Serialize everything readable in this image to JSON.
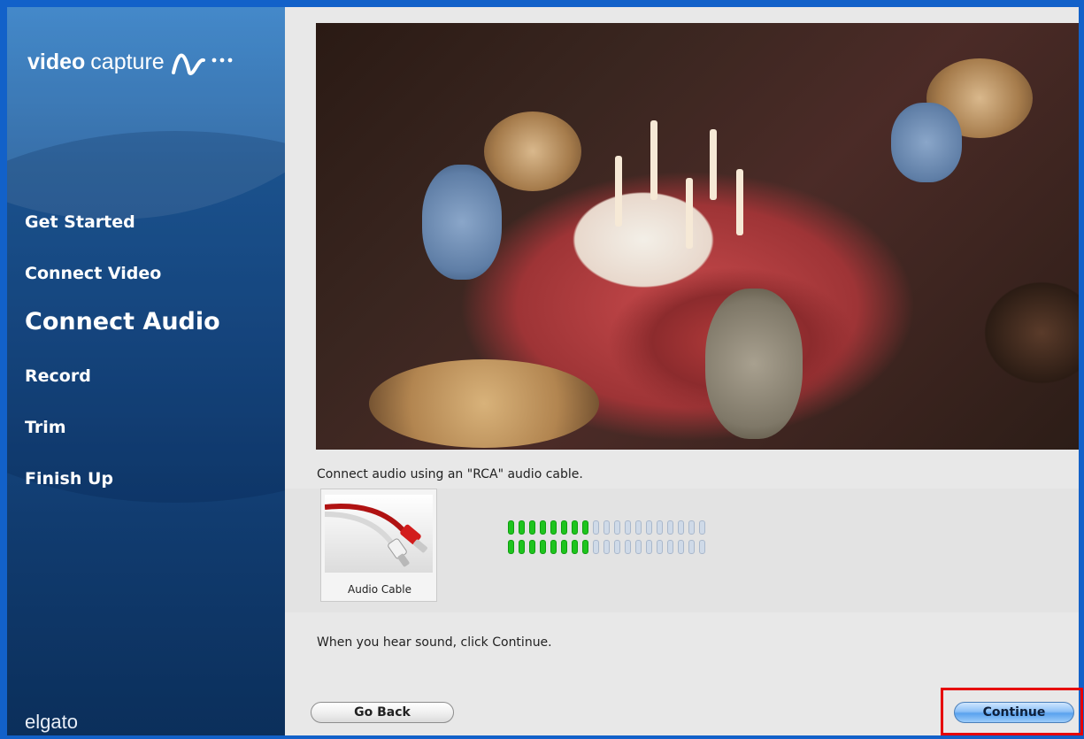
{
  "app": {
    "logo_bold": "video",
    "logo_light": "capture",
    "brand": "elgato"
  },
  "steps": [
    {
      "label": "Get Started",
      "active": false
    },
    {
      "label": "Connect Video",
      "active": false
    },
    {
      "label": "Connect Audio",
      "active": true
    },
    {
      "label": "Record",
      "active": false
    },
    {
      "label": "Trim",
      "active": false
    },
    {
      "label": "Finish Up",
      "active": false
    }
  ],
  "content": {
    "instruction_cable": "Connect audio using an \"RCA\" audio cable.",
    "cable_label": "Audio Cable",
    "instruction_continue": "When you hear sound, click Continue."
  },
  "meter": {
    "total_segments": 19,
    "left_level": 8,
    "right_level": 8
  },
  "buttons": {
    "back": "Go Back",
    "continue": "Continue"
  },
  "colors": {
    "accent_border": "#1261c9",
    "meter_on": "#1ec41e",
    "meter_off": "#cfdae8",
    "highlight": "#e60000"
  },
  "icons": {
    "logo_wave": "waveform-icon",
    "cable": "rca-cable-icon"
  }
}
